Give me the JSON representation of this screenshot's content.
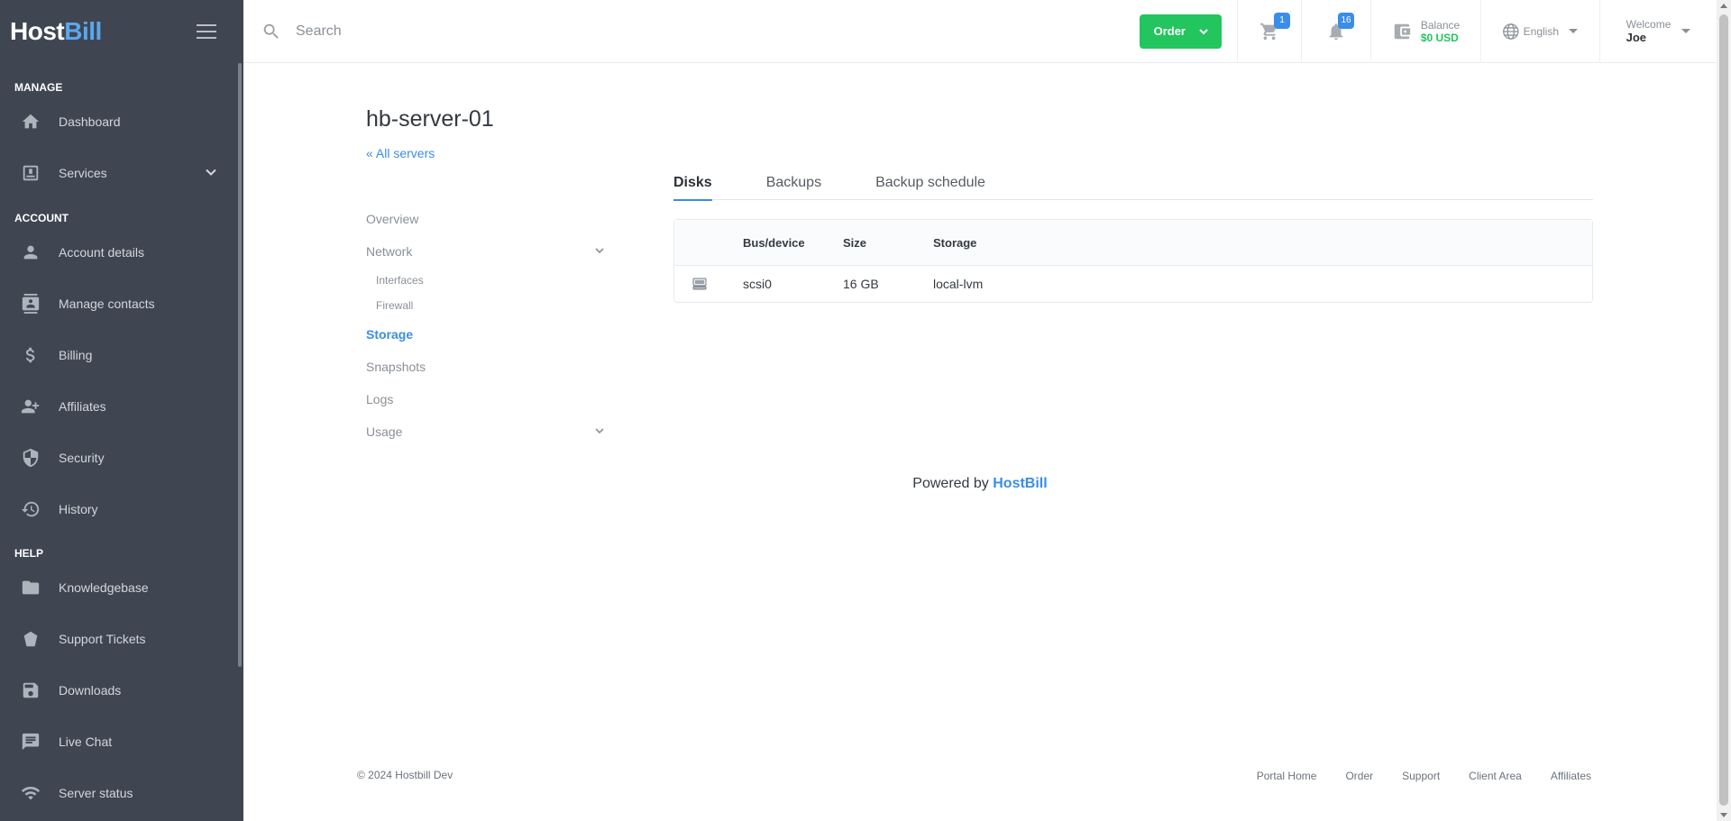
{
  "brand": {
    "host": "Host",
    "bill": "Bill"
  },
  "sidebar": {
    "sections": [
      {
        "title": "MANAGE",
        "items": [
          {
            "label": "Dashboard",
            "icon": "home-icon"
          },
          {
            "label": "Services",
            "icon": "services-icon",
            "expandable": true
          }
        ]
      },
      {
        "title": "ACCOUNT",
        "items": [
          {
            "label": "Account details",
            "icon": "person-icon"
          },
          {
            "label": "Manage contacts",
            "icon": "contacts-icon"
          },
          {
            "label": "Billing",
            "icon": "dollar-icon"
          },
          {
            "label": "Affiliates",
            "icon": "affiliates-icon"
          },
          {
            "label": "Security",
            "icon": "shield-icon"
          },
          {
            "label": "History",
            "icon": "history-icon"
          }
        ]
      },
      {
        "title": "HELP",
        "items": [
          {
            "label": "Knowledgebase",
            "icon": "folder-icon"
          },
          {
            "label": "Support Tickets",
            "icon": "ticket-icon"
          },
          {
            "label": "Downloads",
            "icon": "save-icon"
          },
          {
            "label": "Live Chat",
            "icon": "chat-icon"
          },
          {
            "label": "Server status",
            "icon": "wifi-icon"
          }
        ]
      }
    ]
  },
  "topbar": {
    "search_placeholder": "Search",
    "order_label": "Order",
    "cart_count": "1",
    "notifications_count": "16",
    "balance_label": "Balance",
    "balance_value": "$0 USD",
    "language": "English",
    "welcome_label": "Welcome",
    "user_name": "Joe"
  },
  "page": {
    "title": "hb-server-01",
    "back_link": "« All servers",
    "subnav": {
      "overview": "Overview",
      "network": "Network",
      "interfaces": "Interfaces",
      "firewall": "Firewall",
      "storage": "Storage",
      "snapshots": "Snapshots",
      "logs": "Logs",
      "usage": "Usage"
    },
    "tabs": {
      "disks": "Disks",
      "backups": "Backups",
      "backup_schedule": "Backup schedule"
    },
    "table": {
      "headers": {
        "bus": "Bus/device",
        "size": "Size",
        "storage": "Storage"
      },
      "rows": [
        {
          "bus": "scsi0",
          "size": "16 GB",
          "storage": "local-lvm"
        }
      ]
    }
  },
  "powered": {
    "prefix": "Powered by",
    "brand": "HostBill"
  },
  "footer": {
    "copyright": "© 2024 Hostbill Dev",
    "links": {
      "portal_home": "Portal Home",
      "order": "Order",
      "support": "Support",
      "client_area": "Client Area",
      "affiliates": "Affiliates"
    }
  },
  "colors": {
    "sidebar_bg": "#3f4652",
    "accent": "#3a8de8",
    "order_green": "#22c55e"
  }
}
